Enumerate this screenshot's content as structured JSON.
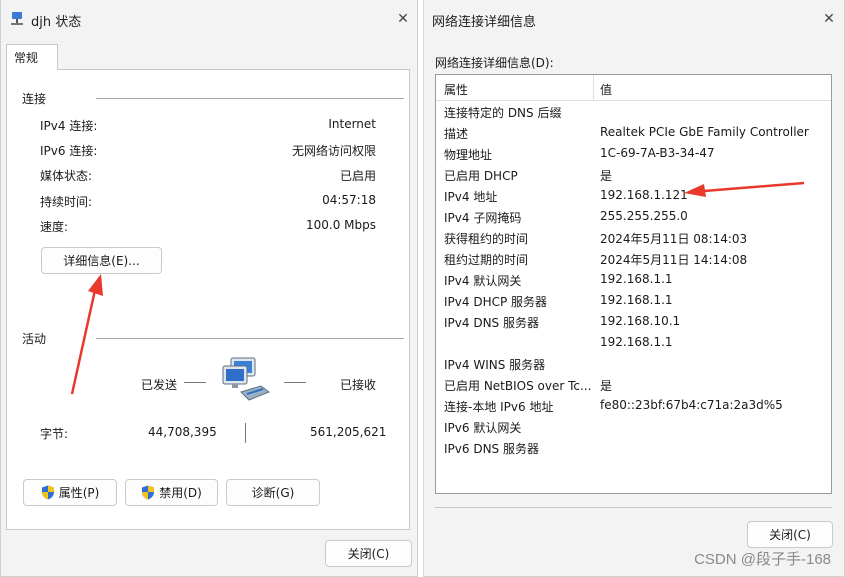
{
  "colors": {
    "accent": "#e8392c",
    "panel": "#ffffff",
    "window": "#f3f3f3"
  },
  "left": {
    "title": "djh 状态",
    "icon": "network-adapter-icon",
    "tab": "常规",
    "connection": {
      "heading": "连接",
      "rows": [
        {
          "label": "IPv4 连接:",
          "value": "Internet"
        },
        {
          "label": "IPv6 连接:",
          "value": "无网络访问权限"
        },
        {
          "label": "媒体状态:",
          "value": "已启用"
        },
        {
          "label": "持续时间:",
          "value": "04:57:18"
        },
        {
          "label": "速度:",
          "value": "100.0 Mbps"
        }
      ],
      "details_button": "详细信息(E)..."
    },
    "activity": {
      "heading": "活动",
      "sent_label": "已发送",
      "received_label": "已接收",
      "bytes_label": "字节:",
      "bytes_sent": "44,708,395",
      "bytes_received": "561,205,621"
    },
    "buttons": {
      "properties": "属性(P)",
      "disable": "禁用(D)",
      "diagnose": "诊断(G)",
      "close": "关闭(C)"
    }
  },
  "right": {
    "title": "网络连接详细信息",
    "subheading": "网络连接详细信息(D):",
    "columns": {
      "property": "属性",
      "value": "值"
    },
    "rows": [
      {
        "p": "连接特定的 DNS 后缀",
        "v": ""
      },
      {
        "p": "描述",
        "v": "Realtek PCIe GbE Family Controller"
      },
      {
        "p": "物理地址",
        "v": "1C-69-7A-B3-34-47"
      },
      {
        "p": "已启用 DHCP",
        "v": "是"
      },
      {
        "p": "IPv4 地址",
        "v": "192.168.1.121"
      },
      {
        "p": "IPv4 子网掩码",
        "v": "255.255.255.0"
      },
      {
        "p": "获得租约的时间",
        "v": "2024年5月11日 08:14:03"
      },
      {
        "p": "租约过期的时间",
        "v": "2024年5月11日 14:14:08"
      },
      {
        "p": "IPv4 默认网关",
        "v": "192.168.1.1"
      },
      {
        "p": "IPv4 DHCP 服务器",
        "v": "192.168.1.1"
      },
      {
        "p": "IPv4 DNS 服务器",
        "v": "192.168.10.1"
      },
      {
        "p": "",
        "v": "192.168.1.1"
      },
      {
        "p": "IPv4 WINS 服务器",
        "v": ""
      },
      {
        "p": "已启用 NetBIOS over Tc...",
        "v": "是"
      },
      {
        "p": "连接-本地 IPv6 地址",
        "v": "fe80::23bf:67b4:c71a:2a3d%5"
      },
      {
        "p": "IPv6 默认网关",
        "v": ""
      },
      {
        "p": "IPv6 DNS 服务器",
        "v": ""
      }
    ],
    "close_button": "关闭(C)"
  },
  "watermark": "CSDN @段子手-168"
}
